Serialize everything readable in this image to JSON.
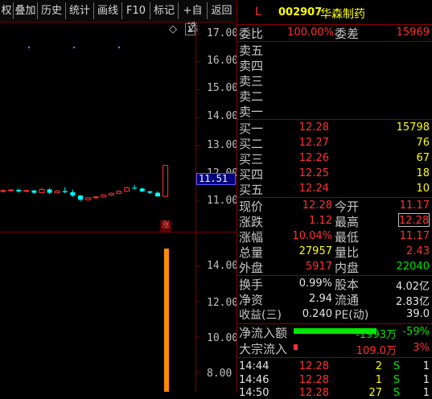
{
  "toolbar": {
    "items": [
      "权",
      "叠加",
      "历史",
      "统计",
      "画线",
      "F10",
      "标记",
      "+自选",
      "返回"
    ]
  },
  "chart": {
    "price_ticks": [
      "17.00",
      "16.00",
      "15.00",
      "14.00",
      "13.00",
      "12.00",
      "11.00"
    ],
    "price_box_label": "11.51",
    "volume_ticks": [
      "14.00",
      "12.00",
      "10.00",
      "8.00"
    ],
    "limit_up_badge": "涨",
    "corner_symbol": "◇",
    "scroll_up_symbol": "▲",
    "candles": [
      {
        "o": 11.35,
        "c": 11.38,
        "h": 11.42,
        "l": 11.3
      },
      {
        "o": 11.38,
        "c": 11.4,
        "h": 11.44,
        "l": 11.34
      },
      {
        "o": 11.4,
        "c": 11.35,
        "h": 11.45,
        "l": 11.3
      },
      {
        "o": 11.35,
        "c": 11.38,
        "h": 11.41,
        "l": 11.32
      },
      {
        "o": 11.38,
        "c": 11.3,
        "h": 11.4,
        "l": 11.26
      },
      {
        "o": 11.3,
        "c": 11.42,
        "h": 11.48,
        "l": 11.28
      },
      {
        "o": 11.42,
        "c": 11.3,
        "h": 11.46,
        "l": 11.25
      },
      {
        "o": 11.3,
        "c": 11.36,
        "h": 11.4,
        "l": 11.27
      },
      {
        "o": 11.36,
        "c": 11.32,
        "h": 11.5,
        "l": 11.28
      },
      {
        "o": 11.32,
        "c": 11.2,
        "h": 11.4,
        "l": 11.15
      },
      {
        "o": 11.2,
        "c": 11.05,
        "h": 11.22,
        "l": 11.0
      },
      {
        "o": 11.05,
        "c": 11.12,
        "h": 11.14,
        "l": 11.02
      },
      {
        "o": 11.12,
        "c": 11.15,
        "h": 11.18,
        "l": 11.08
      },
      {
        "o": 11.15,
        "c": 11.22,
        "h": 11.25,
        "l": 11.12
      },
      {
        "o": 11.22,
        "c": 11.28,
        "h": 11.3,
        "l": 11.18
      },
      {
        "o": 11.28,
        "c": 11.35,
        "h": 11.38,
        "l": 11.25
      },
      {
        "o": 11.35,
        "c": 11.48,
        "h": 11.52,
        "l": 11.32
      },
      {
        "o": 11.48,
        "c": 11.45,
        "h": 11.58,
        "l": 11.42
      },
      {
        "o": 11.45,
        "c": 11.35,
        "h": 11.48,
        "l": 11.32
      },
      {
        "o": 11.35,
        "c": 11.3,
        "h": 11.37,
        "l": 11.26
      },
      {
        "o": 11.3,
        "c": 11.17,
        "h": 11.35,
        "l": 11.15
      },
      {
        "o": 11.17,
        "c": 12.28,
        "h": 12.28,
        "l": 11.17
      }
    ],
    "colors": {
      "up": "#ff3232",
      "down": "#00ffff",
      "volume": "#ff8c00",
      "grid": "#7a0000"
    }
  },
  "header": {
    "flag": "L",
    "code": "002907",
    "name": "华森制药"
  },
  "weibi": {
    "label1": "委比",
    "value1": "100.00%",
    "label2": "委差",
    "value2": "15969"
  },
  "asks": [
    {
      "label": "卖五"
    },
    {
      "label": "卖四"
    },
    {
      "label": "卖三"
    },
    {
      "label": "卖二"
    },
    {
      "label": "卖一"
    }
  ],
  "bids": [
    {
      "label": "买一",
      "price": "12.28",
      "vol": "15798"
    },
    {
      "label": "买二",
      "price": "12.27",
      "vol": "76"
    },
    {
      "label": "买三",
      "price": "12.26",
      "vol": "67"
    },
    {
      "label": "买四",
      "price": "12.25",
      "vol": "18"
    },
    {
      "label": "买五",
      "price": "12.24",
      "vol": "10"
    }
  ],
  "quote": [
    {
      "l1": "现价",
      "v1": "12.28",
      "l2": "今开",
      "v2": "11.17"
    },
    {
      "l1": "涨跌",
      "v1": "1.12",
      "l2": "最高",
      "v2": "12.28"
    },
    {
      "l1": "涨幅",
      "v1": "10.04%",
      "l2": "最低",
      "v2": "11.17"
    },
    {
      "l1": "总量",
      "v1": "27957",
      "l2": "量比",
      "v2": "2.43"
    },
    {
      "l1": "外盘",
      "v1": "5917",
      "l2": "内盘",
      "v2": "22040"
    }
  ],
  "fund": [
    {
      "l1": "换手",
      "v1": "0.99%",
      "l2": "股本",
      "v2": "4.02亿"
    },
    {
      "l1": "净资",
      "v1": "2.94",
      "l2": "流通",
      "v2": "2.83亿"
    },
    {
      "l1": "收益(三)",
      "v1": "0.240",
      "l2": "PE(动)",
      "v2": "39.0"
    }
  ],
  "flow": [
    {
      "label": "净流入额",
      "amount": "-1993万",
      "pct": "-59%",
      "bar_ratio": 0.59
    },
    {
      "label": "大宗流入",
      "amount": "109.0万",
      "pct": "3%",
      "bar_ratio": 0.03
    }
  ],
  "ticks": [
    {
      "time": "14:44",
      "price": "12.28",
      "vol": "2",
      "side": "S",
      "n": "1"
    },
    {
      "time": "14:46",
      "price": "12.28",
      "vol": "1",
      "side": "S",
      "n": "1"
    },
    {
      "time": "14:50",
      "price": "12.28",
      "vol": "27",
      "side": "S",
      "n": "1"
    }
  ]
}
